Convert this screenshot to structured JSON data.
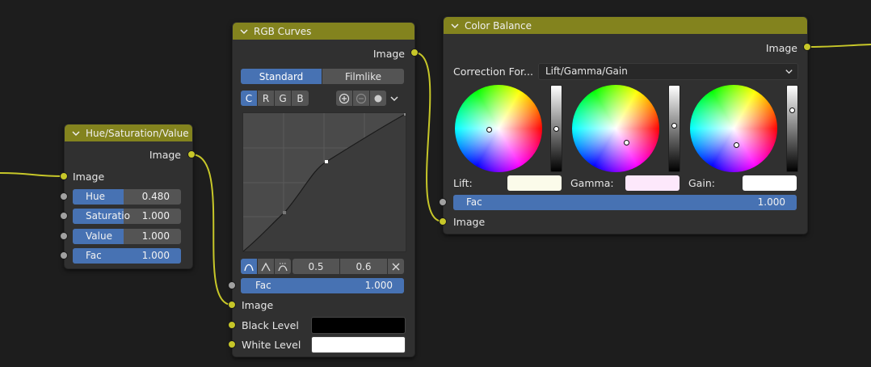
{
  "colors": {
    "header": "#83831e",
    "node_bg": "#303030",
    "accent": "#4772b3",
    "wire": "#c7c729",
    "socket_gray": "#a1a1a1"
  },
  "hsv_node": {
    "title": "Hue/Saturation/Value",
    "output_label": "Image",
    "input_label": "Image",
    "fields": [
      {
        "label": "Hue",
        "value": "0.480",
        "fill": 0.48
      },
      {
        "label": "Saturatio",
        "value": "1.000",
        "fill": 0.5
      },
      {
        "label": "Value",
        "value": "1.000",
        "fill": 0.5
      },
      {
        "label": "Fac",
        "value": "1.000",
        "fill": 1.0
      }
    ]
  },
  "curves_node": {
    "title": "RGB Curves",
    "output_label": "Image",
    "tabs": {
      "standard": "Standard",
      "filmlike": "Filmlike"
    },
    "channels": [
      "C",
      "R",
      "G",
      "B"
    ],
    "handles": {
      "x": "0.5",
      "y": "0.6"
    },
    "fac": {
      "label": "Fac",
      "value": "1.000"
    },
    "input_label": "Image",
    "black_level": "Black Level",
    "white_level": "White Level"
  },
  "balance_node": {
    "title": "Color Balance",
    "output_label": "Image",
    "correction_label": "Correction For...",
    "correction_value": "Lift/Gamma/Gain",
    "lift_label": "Lift:",
    "gamma_label": "Gamma:",
    "gain_label": "Gain:",
    "lift_color": "#fbfbea",
    "gamma_color": "#fde8fb",
    "gain_color": "#ffffff",
    "fac": {
      "label": "Fac",
      "value": "1.000"
    },
    "input_label": "Image"
  }
}
